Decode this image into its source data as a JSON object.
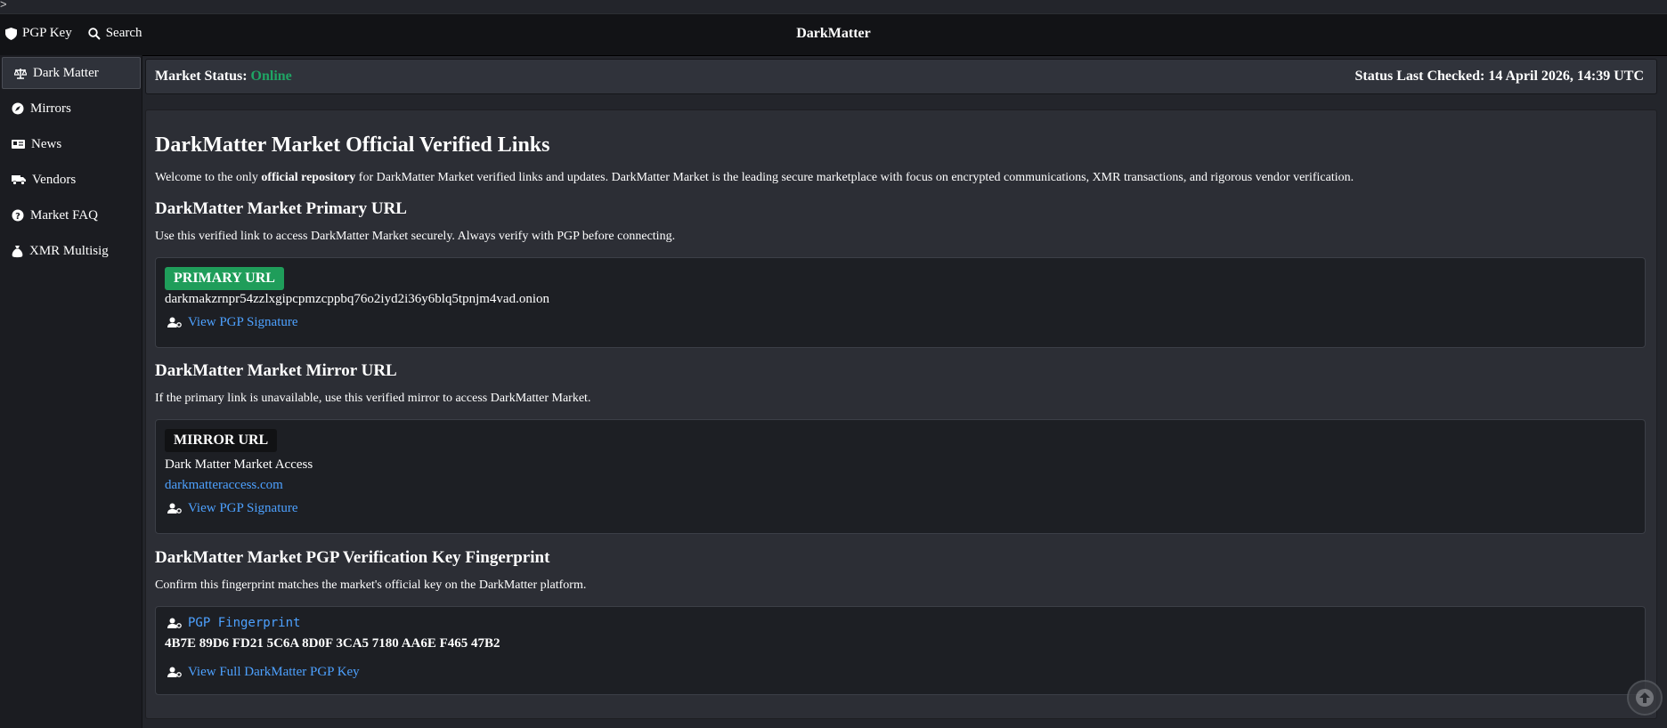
{
  "caret": ">",
  "topbar": {
    "nav": [
      {
        "label": "PGP Key",
        "icon": "shield-icon"
      },
      {
        "label": "Search",
        "icon": "search-icon"
      }
    ],
    "brand": "DarkMatter"
  },
  "sidebar": {
    "items": [
      {
        "label": "Dark Matter",
        "icon": "balance-scale-icon",
        "active": true
      },
      {
        "label": "Mirrors",
        "icon": "compass-icon"
      },
      {
        "label": "News",
        "icon": "newspaper-icon"
      },
      {
        "label": "Vendors",
        "icon": "truck-icon"
      },
      {
        "label": "Market FAQ",
        "icon": "question-circle-icon"
      },
      {
        "label": "XMR Multisig",
        "icon": "money-bag-icon"
      }
    ]
  },
  "status": {
    "label": "Market Status:",
    "value": "Online",
    "checked": "Status Last Checked: 14 April 2026, 14:39 UTC"
  },
  "main": {
    "title": "DarkMatter Market Official Verified Links",
    "intro": {
      "before": "Welcome to the only ",
      "bold": "official repository",
      "after": " for DarkMatter Market verified links and updates. DarkMatter Market is the leading secure marketplace with focus on encrypted communications, XMR transactions, and rigorous vendor verification."
    },
    "primary": {
      "heading": "DarkMatter Market Primary URL",
      "description": "Use this verified link to access DarkMatter Market securely. Always verify with PGP before connecting.",
      "badge": "PRIMARY URL",
      "url": "darkmakzrnpr54zzlxgipcpmzcppbq76o2iyd2i36y6blq5tpnjm4vad.onion",
      "sig_label": "View PGP Signature"
    },
    "mirror": {
      "heading": "DarkMatter Market Mirror URL",
      "description": "If the primary link is unavailable, use this verified mirror to access DarkMatter Market.",
      "badge": "MIRROR URL",
      "name": "Dark Matter Market Access",
      "url": "darkmatteraccess.com",
      "sig_label": "View PGP Signature"
    },
    "fingerprint": {
      "heading": "DarkMatter Market PGP Verification Key Fingerprint",
      "description": "Confirm this fingerprint matches the market's official key on the DarkMatter platform.",
      "label": "PGP Fingerprint",
      "value": "4B7E 89D6 FD21 5C6A 8D0F 3CA5 7180 AA6E F465 47B2",
      "key_link": "View Full DarkMatter PGP Key"
    }
  },
  "colors": {
    "online": "#1fa564",
    "link": "#4da1ff",
    "badge_primary": "#1f9d5a"
  }
}
